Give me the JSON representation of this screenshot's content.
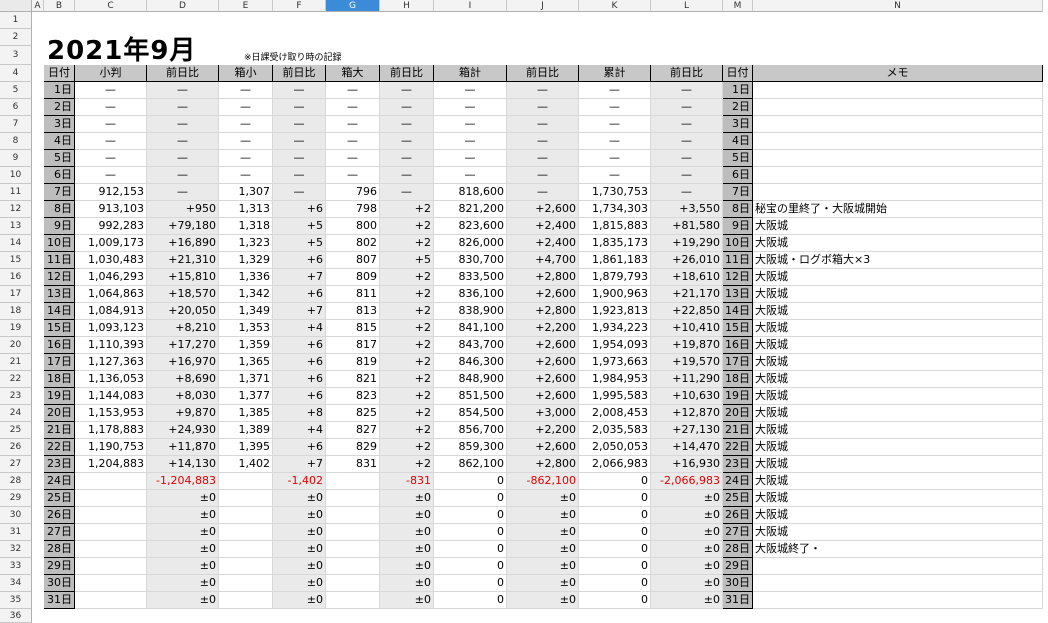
{
  "columns": [
    "A",
    "B",
    "C",
    "D",
    "E",
    "F",
    "G",
    "H",
    "I",
    "J",
    "K",
    "L",
    "M",
    "N"
  ],
  "selected_column": "G",
  "title": "2021年9月",
  "note": "※日課受け取り時の記録",
  "headers": [
    "日付",
    "小判",
    "前日比",
    "箱小",
    "前日比",
    "箱大",
    "前日比",
    "箱計",
    "前日比",
    "累計",
    "前日比",
    "日付",
    "メモ"
  ],
  "rows": [
    [
      "1日",
      "—",
      "—",
      "—",
      "—",
      "—",
      "—",
      "—",
      "—",
      "—",
      "—",
      "1日",
      ""
    ],
    [
      "2日",
      "—",
      "—",
      "—",
      "—",
      "—",
      "—",
      "—",
      "—",
      "—",
      "—",
      "2日",
      ""
    ],
    [
      "3日",
      "—",
      "—",
      "—",
      "—",
      "—",
      "—",
      "—",
      "—",
      "—",
      "—",
      "3日",
      ""
    ],
    [
      "4日",
      "—",
      "—",
      "—",
      "—",
      "—",
      "—",
      "—",
      "—",
      "—",
      "—",
      "4日",
      ""
    ],
    [
      "5日",
      "—",
      "—",
      "—",
      "—",
      "—",
      "—",
      "—",
      "—",
      "—",
      "—",
      "5日",
      ""
    ],
    [
      "6日",
      "—",
      "—",
      "—",
      "—",
      "—",
      "—",
      "—",
      "—",
      "—",
      "—",
      "6日",
      ""
    ],
    [
      "7日",
      "912,153",
      "—",
      "1,307",
      "—",
      "796",
      "—",
      "818,600",
      "—",
      "1,730,753",
      "—",
      "7日",
      ""
    ],
    [
      "8日",
      "913,103",
      "+950",
      "1,313",
      "+6",
      "798",
      "+2",
      "821,200",
      "+2,600",
      "1,734,303",
      "+3,550",
      "8日",
      "秘宝の里終了・大阪城開始"
    ],
    [
      "9日",
      "992,283",
      "+79,180",
      "1,318",
      "+5",
      "800",
      "+2",
      "823,600",
      "+2,400",
      "1,815,883",
      "+81,580",
      "9日",
      "大阪城"
    ],
    [
      "10日",
      "1,009,173",
      "+16,890",
      "1,323",
      "+5",
      "802",
      "+2",
      "826,000",
      "+2,400",
      "1,835,173",
      "+19,290",
      "10日",
      "大阪城"
    ],
    [
      "11日",
      "1,030,483",
      "+21,310",
      "1,329",
      "+6",
      "807",
      "+5",
      "830,700",
      "+4,700",
      "1,861,183",
      "+26,010",
      "11日",
      "大阪城・ログボ箱大×3"
    ],
    [
      "12日",
      "1,046,293",
      "+15,810",
      "1,336",
      "+7",
      "809",
      "+2",
      "833,500",
      "+2,800",
      "1,879,793",
      "+18,610",
      "12日",
      "大阪城"
    ],
    [
      "13日",
      "1,064,863",
      "+18,570",
      "1,342",
      "+6",
      "811",
      "+2",
      "836,100",
      "+2,600",
      "1,900,963",
      "+21,170",
      "13日",
      "大阪城"
    ],
    [
      "14日",
      "1,084,913",
      "+20,050",
      "1,349",
      "+7",
      "813",
      "+2",
      "838,900",
      "+2,800",
      "1,923,813",
      "+22,850",
      "14日",
      "大阪城"
    ],
    [
      "15日",
      "1,093,123",
      "+8,210",
      "1,353",
      "+4",
      "815",
      "+2",
      "841,100",
      "+2,200",
      "1,934,223",
      "+10,410",
      "15日",
      "大阪城"
    ],
    [
      "16日",
      "1,110,393",
      "+17,270",
      "1,359",
      "+6",
      "817",
      "+2",
      "843,700",
      "+2,600",
      "1,954,093",
      "+19,870",
      "16日",
      "大阪城"
    ],
    [
      "17日",
      "1,127,363",
      "+16,970",
      "1,365",
      "+6",
      "819",
      "+2",
      "846,300",
      "+2,600",
      "1,973,663",
      "+19,570",
      "17日",
      "大阪城"
    ],
    [
      "18日",
      "1,136,053",
      "+8,690",
      "1,371",
      "+6",
      "821",
      "+2",
      "848,900",
      "+2,600",
      "1,984,953",
      "+11,290",
      "18日",
      "大阪城"
    ],
    [
      "19日",
      "1,144,083",
      "+8,030",
      "1,377",
      "+6",
      "823",
      "+2",
      "851,500",
      "+2,600",
      "1,995,583",
      "+10,630",
      "19日",
      "大阪城"
    ],
    [
      "20日",
      "1,153,953",
      "+9,870",
      "1,385",
      "+8",
      "825",
      "+2",
      "854,500",
      "+3,000",
      "2,008,453",
      "+12,870",
      "20日",
      "大阪城"
    ],
    [
      "21日",
      "1,178,883",
      "+24,930",
      "1,389",
      "+4",
      "827",
      "+2",
      "856,700",
      "+2,200",
      "2,035,583",
      "+27,130",
      "21日",
      "大阪城"
    ],
    [
      "22日",
      "1,190,753",
      "+11,870",
      "1,395",
      "+6",
      "829",
      "+2",
      "859,300",
      "+2,600",
      "2,050,053",
      "+14,470",
      "22日",
      "大阪城"
    ],
    [
      "23日",
      "1,204,883",
      "+14,130",
      "1,402",
      "+7",
      "831",
      "+2",
      "862,100",
      "+2,800",
      "2,066,983",
      "+16,930",
      "23日",
      "大阪城"
    ],
    [
      "24日",
      "",
      "-1,204,883",
      "",
      "-1,402",
      "",
      "-831",
      "0",
      "-862,100",
      "0",
      "-2,066,983",
      "24日",
      "大阪城"
    ],
    [
      "25日",
      "",
      "±0",
      "",
      "±0",
      "",
      "±0",
      "0",
      "±0",
      "0",
      "±0",
      "25日",
      "大阪城"
    ],
    [
      "26日",
      "",
      "±0",
      "",
      "±0",
      "",
      "±0",
      "0",
      "±0",
      "0",
      "±0",
      "26日",
      "大阪城"
    ],
    [
      "27日",
      "",
      "±0",
      "",
      "±0",
      "",
      "±0",
      "0",
      "±0",
      "0",
      "±0",
      "27日",
      "大阪城"
    ],
    [
      "28日",
      "",
      "±0",
      "",
      "±0",
      "",
      "±0",
      "0",
      "±0",
      "0",
      "±0",
      "28日",
      "大阪城終了・"
    ],
    [
      "29日",
      "",
      "±0",
      "",
      "±0",
      "",
      "±0",
      "0",
      "±0",
      "0",
      "±0",
      "29日",
      ""
    ],
    [
      "30日",
      "",
      "±0",
      "",
      "±0",
      "",
      "±0",
      "0",
      "±0",
      "0",
      "±0",
      "30日",
      ""
    ],
    [
      "31日",
      "",
      "±0",
      "",
      "±0",
      "",
      "±0",
      "0",
      "±0",
      "0",
      "±0",
      "31日",
      ""
    ]
  ],
  "colors": {
    "negative": "#e00000",
    "day_fill": "#bdbdbd",
    "header_fill": "#c8c8c8",
    "diff_fill": "#eaeaea",
    "selected_column": "#3c8bd8"
  }
}
